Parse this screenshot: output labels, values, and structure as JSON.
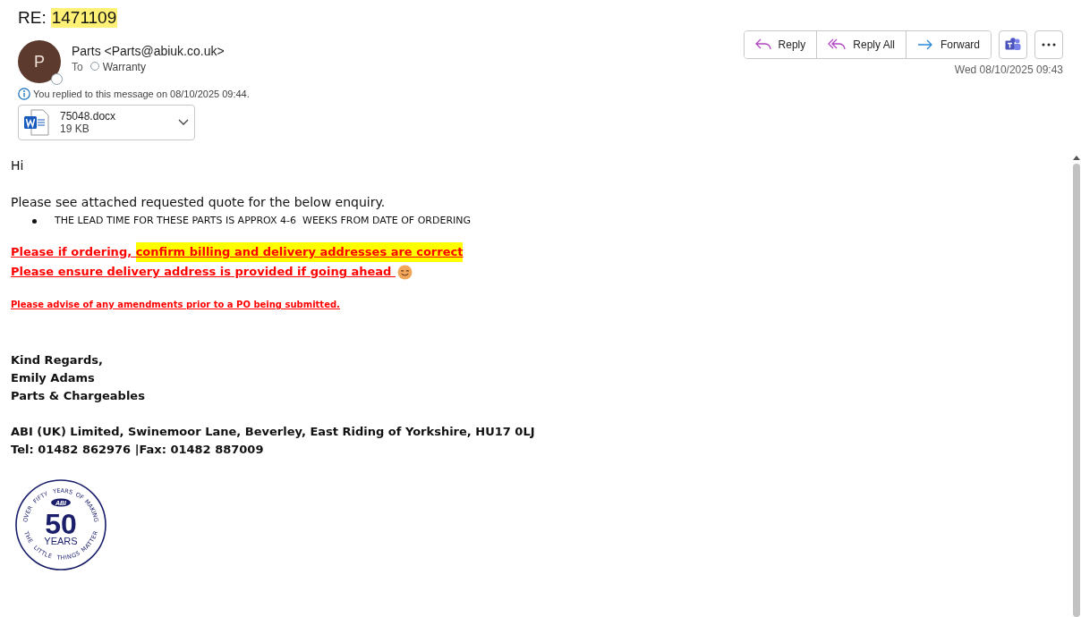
{
  "subject": {
    "prefix": "RE:",
    "highlighted": "1471109"
  },
  "sender": {
    "initial": "P",
    "name": "Parts <Parts@abiuk.co.uk>",
    "to_label": "To",
    "recipient": "Warranty"
  },
  "actions": [
    {
      "kind": "reply",
      "label": "Reply"
    },
    {
      "kind": "reply_all",
      "label": "Reply All"
    },
    {
      "kind": "forward",
      "label": "Forward"
    }
  ],
  "date": "Wed 08/10/2025 09:43",
  "info": "You replied to this message on 08/10/2025 09:44.",
  "attachment": {
    "name": "75048.docx",
    "size": "19 KB"
  },
  "body": [
    {
      "kind": "plain",
      "lines": [
        {
          "segments": [
            {
              "kind": "text",
              "text": "Hi"
            }
          ]
        }
      ]
    },
    {
      "kind": "plain",
      "lines": [
        {
          "segments": [
            {
              "kind": "text",
              "text": "Please see attached requested quote for the below enquiry."
            }
          ]
        }
      ]
    },
    {
      "kind": "bullet",
      "lines": [
        {
          "segments": [
            {
              "kind": "text",
              "text": "THE LEAD TIME FOR THESE PARTS IS APPROX 4-6  WEEKS FROM DATE OF ORDERING"
            }
          ]
        }
      ]
    },
    {
      "kind": "alert",
      "lines": [
        {
          "segments": [
            {
              "kind": "text",
              "text": "Please if ordering, "
            },
            {
              "kind": "highlight",
              "text": "confirm billing and delivery addresses are correct"
            }
          ]
        },
        {
          "segments": [
            {
              "kind": "text",
              "text": "Please ensure delivery address is provided if going ahead "
            },
            {
              "kind": "smiley"
            }
          ]
        }
      ]
    },
    {
      "kind": "alert_small",
      "lines": [
        {
          "segments": [
            {
              "kind": "text",
              "text": "Please advise of any amendments prior to a PO being submitted."
            }
          ]
        }
      ]
    },
    {
      "kind": "signature",
      "lines": [
        {
          "segments": [
            {
              "kind": "text",
              "text": "Kind Regards,"
            }
          ]
        },
        {
          "segments": [
            {
              "kind": "text",
              "text": "Emily Adams"
            }
          ]
        },
        {
          "segments": [
            {
              "kind": "text",
              "text": "Parts & Chargeables"
            }
          ]
        }
      ]
    },
    {
      "kind": "signature",
      "lines": [
        {
          "segments": [
            {
              "kind": "text",
              "text": "ABI (UK) Limited, Swinemoor Lane, Beverley, East Riding of Yorkshire, HU17 0LJ"
            }
          ]
        },
        {
          "segments": [
            {
              "kind": "text",
              "text": "Tel: 01482 862976 |Fax: 01482 887009"
            }
          ]
        }
      ]
    }
  ],
  "logo": {
    "top_arc": [
      "OVER",
      "FIFTY",
      "YEARS",
      "OF",
      "MAKING"
    ],
    "badge": "ABI",
    "number": "50",
    "word": "YEARS",
    "bottom_arc": [
      "THE",
      "LITTLE",
      "THINGS",
      "MATTER"
    ]
  }
}
